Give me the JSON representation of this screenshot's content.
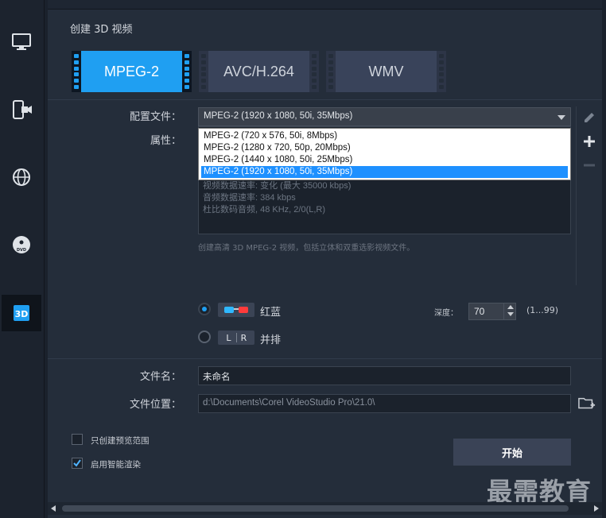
{
  "window": {
    "title": "创建 3D 视频"
  },
  "sidebar": {
    "items": [
      {
        "icon": "monitor-icon",
        "active": false
      },
      {
        "icon": "mobile-device-icon",
        "active": false
      },
      {
        "icon": "globe-icon",
        "active": false
      },
      {
        "icon": "dvd-disc-icon",
        "active": false
      },
      {
        "icon": "3d-icon",
        "text": "3D",
        "active": true
      }
    ]
  },
  "format_tabs": [
    {
      "label": "MPEG-2",
      "active": true
    },
    {
      "label": "AVC/H.264",
      "active": false
    },
    {
      "label": "WMV",
      "active": false
    }
  ],
  "profile": {
    "label": "配置文件：",
    "selected": "MPEG-2 (1920 x 1080, 50i, 35Mbps)",
    "options": [
      "MPEG-2 (720 x 576, 50i, 8Mbps)",
      "MPEG-2 (1280 x 720, 50p, 20Mbps)",
      "MPEG-2 (1440 x 1080, 50i, 25Mbps)",
      "MPEG-2 (1920 x 1080, 50i, 35Mbps)"
    ],
    "highlighted_index": 3
  },
  "properties": {
    "label": "属性：",
    "lines": [
      "视频数据速率: 变化 (最大 35000 kbps)",
      "音频数据速率: 384 kbps",
      "杜比数码音频, 48 KHz, 2/0(L,R)"
    ],
    "description": "创建高清 3D MPEG-2 视频，包括立体和双重选影视频文件。"
  },
  "modes": [
    {
      "label": "红蓝",
      "selected": true,
      "icon": "red-blue-glasses-icon"
    },
    {
      "label": "并排",
      "selected": false,
      "icon": "side-by-side-lr-icon",
      "badge_left": "L",
      "badge_right": "R"
    }
  ],
  "depth": {
    "label": "深度：",
    "value": "70",
    "range": "(1...99)"
  },
  "filename": {
    "label": "文件名：",
    "value": "未命名"
  },
  "location": {
    "label": "文件位置：",
    "value": "d:\\Documents\\Corel VideoStudio Pro\\21.0\\"
  },
  "options": [
    {
      "label": "只创建预览范围",
      "checked": false
    },
    {
      "label": "启用智能渲染",
      "checked": true
    }
  ],
  "start_button": {
    "label": "开始"
  },
  "watermark": {
    "text": "最需教育"
  },
  "colors": {
    "accent": "#1f9ff2",
    "panel": "#242d3a",
    "sidebar": "#1c232e"
  }
}
